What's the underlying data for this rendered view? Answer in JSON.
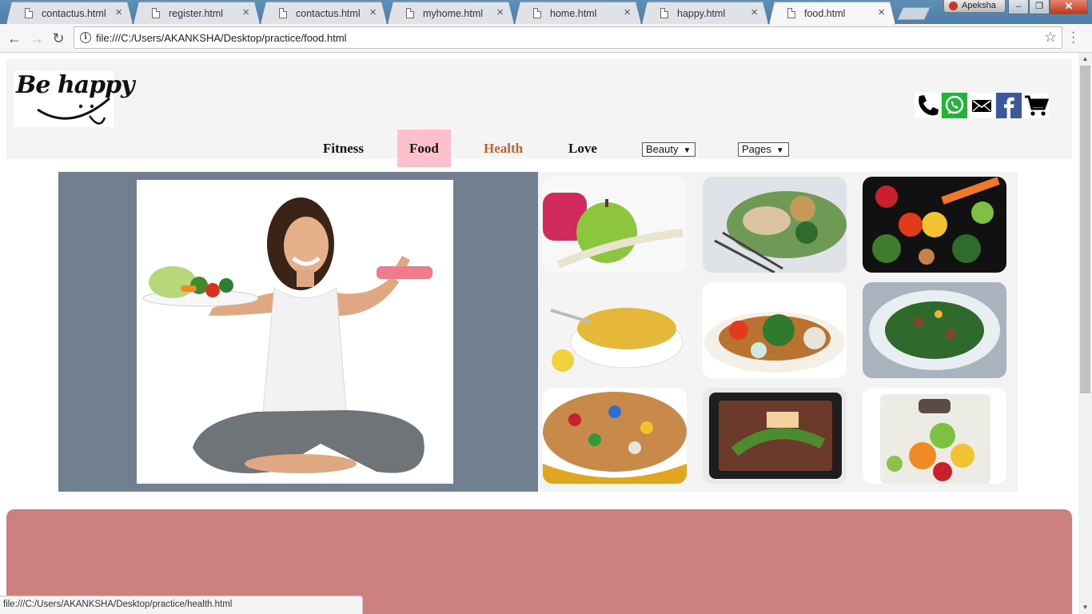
{
  "browser": {
    "tabs": [
      {
        "label": "contactus.html",
        "active": false
      },
      {
        "label": "register.html",
        "active": false
      },
      {
        "label": "contactus.html",
        "active": false
      },
      {
        "label": "myhome.html",
        "active": false
      },
      {
        "label": "home.html",
        "active": false
      },
      {
        "label": "happy.html",
        "active": false
      },
      {
        "label": "food.html",
        "active": true
      }
    ],
    "user_name": "Apeksha",
    "url": "file:///C:/Users/AKANKSHA/Desktop/practice/food.html",
    "status_url": "file:///C:/Users/AKANKSHA/Desktop/practice/health.html"
  },
  "page": {
    "logo_text": "Be happy",
    "social_icons": [
      "phone-icon",
      "whatsapp-icon",
      "mail-icon",
      "facebook-icon",
      "cart-icon"
    ],
    "nav": {
      "fitness": "Fitness",
      "food": "Food",
      "health": "Health",
      "love": "Love",
      "beauty_select": "Beauty",
      "pages_select": "Pages"
    },
    "active_nav": "Food",
    "colors": {
      "active_nav_bg": "#ffc0cb",
      "health_link": "#c0622f",
      "hero_bg": "#708090",
      "footer_band": "#cd8080"
    },
    "hero_image": "woman-with-salad-and-dumbbell",
    "gallery": [
      "apple-dumbbells-tape",
      "chicken-salad-plate",
      "vegetables-assortment",
      "rice-bowl-lemon",
      "vegetable-soup",
      "greens-plate",
      "mixed-nuts-bowl",
      "quinoa-salmon-box",
      "fruits-on-scale"
    ]
  }
}
